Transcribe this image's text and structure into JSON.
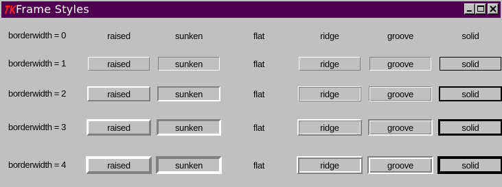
{
  "window": {
    "title": "Frame Styles",
    "app_icon": "tk-logo-icon",
    "controls": [
      "minimize-icon",
      "maximize-icon",
      "close-icon"
    ],
    "title_bar_color": "#500050",
    "background_color": "#c0c0c0"
  },
  "rows": [
    {
      "label": "borderwidth = 0",
      "borderwidth": 0
    },
    {
      "label": "borderwidth = 1",
      "borderwidth": 1
    },
    {
      "label": "borderwidth = 2",
      "borderwidth": 2
    },
    {
      "label": "borderwidth = 3",
      "borderwidth": 3
    },
    {
      "label": "borderwidth = 4",
      "borderwidth": 4
    }
  ],
  "reliefs": [
    "raised",
    "sunken",
    "flat",
    "ridge",
    "groove",
    "solid"
  ]
}
